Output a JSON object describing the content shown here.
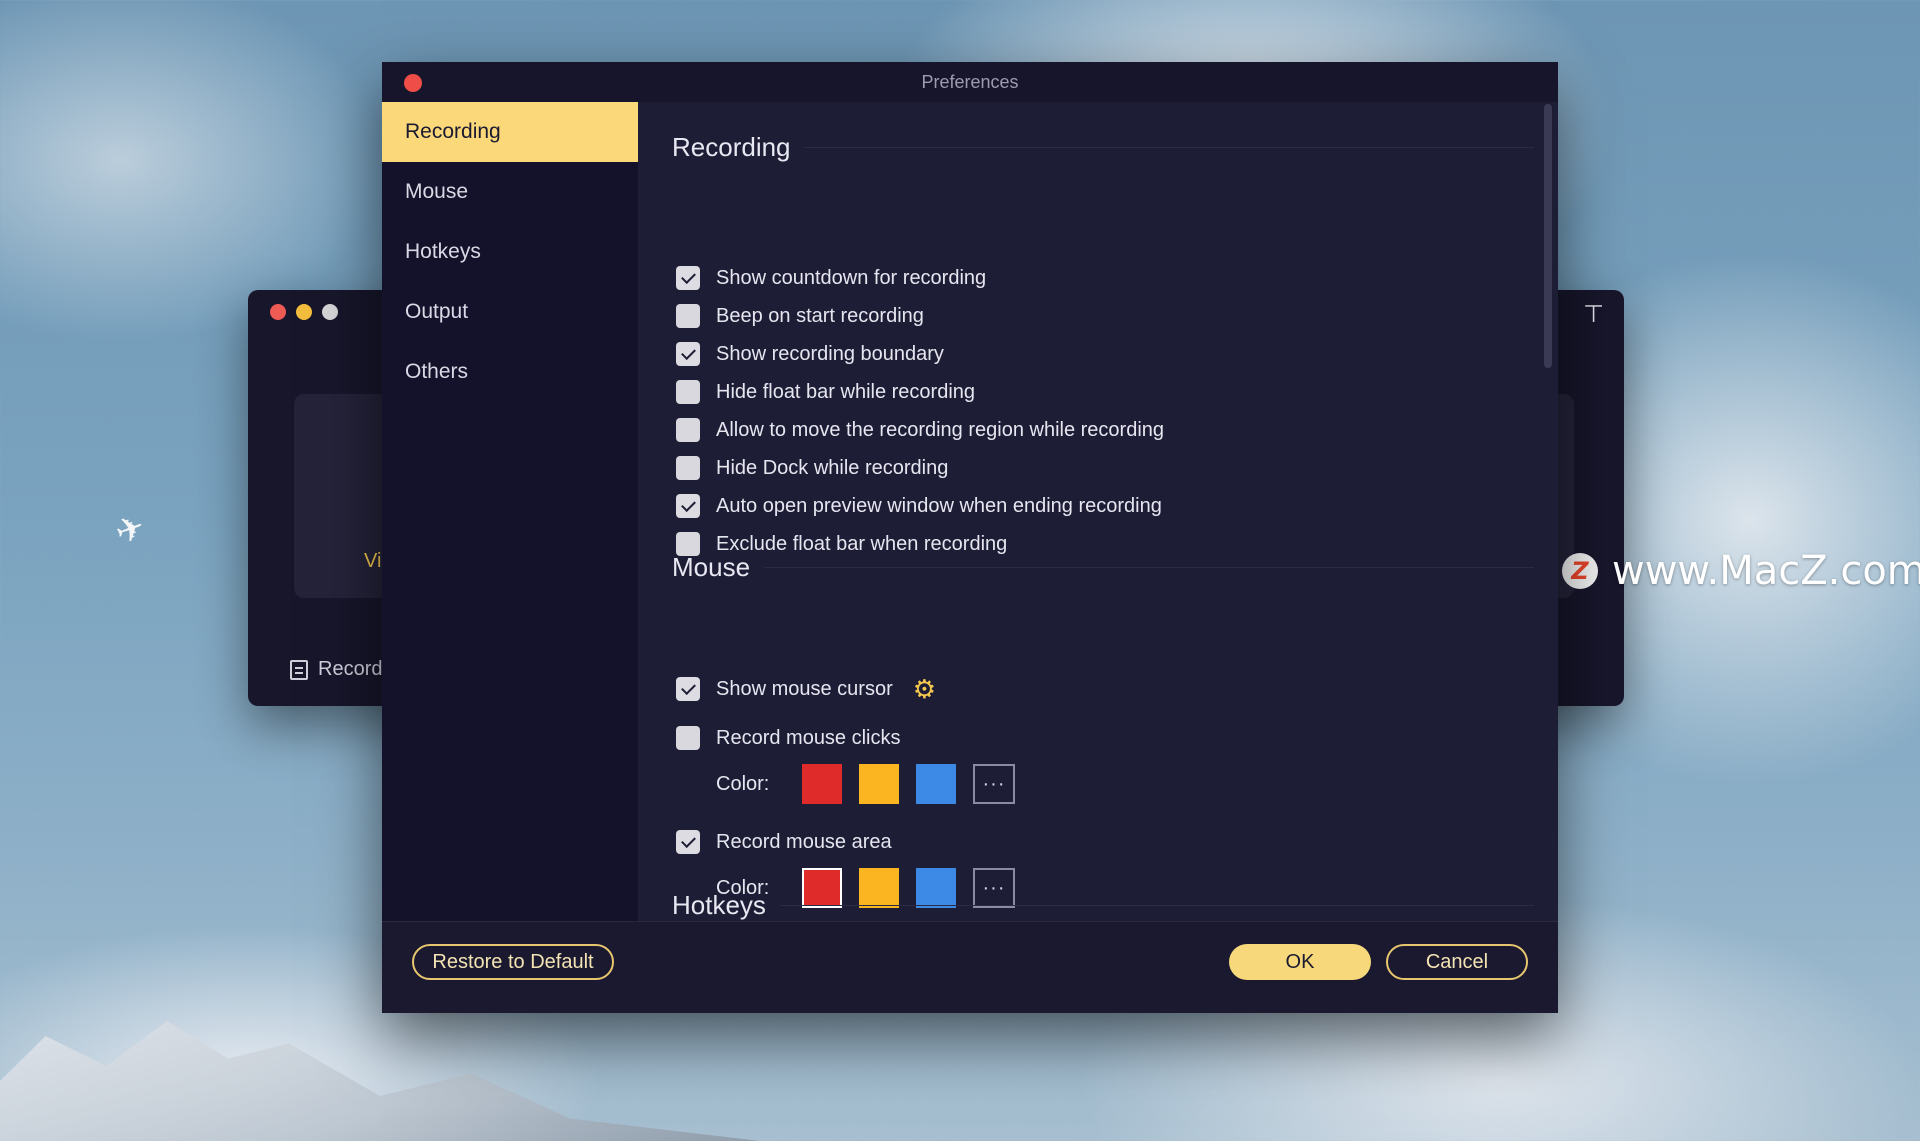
{
  "dialog": {
    "title": "Preferences"
  },
  "sidebar": {
    "items": [
      {
        "label": "Recording",
        "active": true
      },
      {
        "label": "Mouse",
        "active": false
      },
      {
        "label": "Hotkeys",
        "active": false
      },
      {
        "label": "Output",
        "active": false
      },
      {
        "label": "Others",
        "active": false
      }
    ]
  },
  "recording": {
    "title": "Recording",
    "options": [
      {
        "label": "Show countdown for recording",
        "checked": true
      },
      {
        "label": "Beep on start recording",
        "checked": false
      },
      {
        "label": "Show recording boundary",
        "checked": true
      },
      {
        "label": "Hide float bar while recording",
        "checked": false
      },
      {
        "label": "Allow to move the recording region while recording",
        "checked": false
      },
      {
        "label": "Hide Dock while recording",
        "checked": false
      },
      {
        "label": "Auto open preview window when ending recording",
        "checked": true
      },
      {
        "label": "Exclude float bar when recording",
        "checked": false
      }
    ]
  },
  "mouse": {
    "title": "Mouse",
    "show_cursor": {
      "label": "Show mouse cursor",
      "checked": true
    },
    "record_clicks": {
      "label": "Record mouse clicks",
      "checked": false
    },
    "clicks_color": {
      "label": "Color:",
      "selected": "#e02b2b"
    },
    "record_area": {
      "label": "Record mouse area",
      "checked": true
    },
    "area_color": {
      "label": "Color:",
      "selected": "#e02b2b"
    },
    "swatches": [
      "#e02b2b",
      "#fbb520",
      "#3d8ae6"
    ],
    "more_label": "···"
  },
  "hotkeys": {
    "title": "Hotkeys"
  },
  "footer": {
    "restore_label": "Restore to Default",
    "ok_label": "OK",
    "cancel_label": "Cancel"
  },
  "background_window": {
    "card_label": "Vi",
    "record_label": "Record"
  },
  "watermark": {
    "logo_letter": "Z",
    "text": "www.MacZ.com"
  },
  "colors": {
    "accent": "#fbd97a",
    "dialog_bg": "#1e1d36",
    "sidebar_bg": "#13122a"
  }
}
